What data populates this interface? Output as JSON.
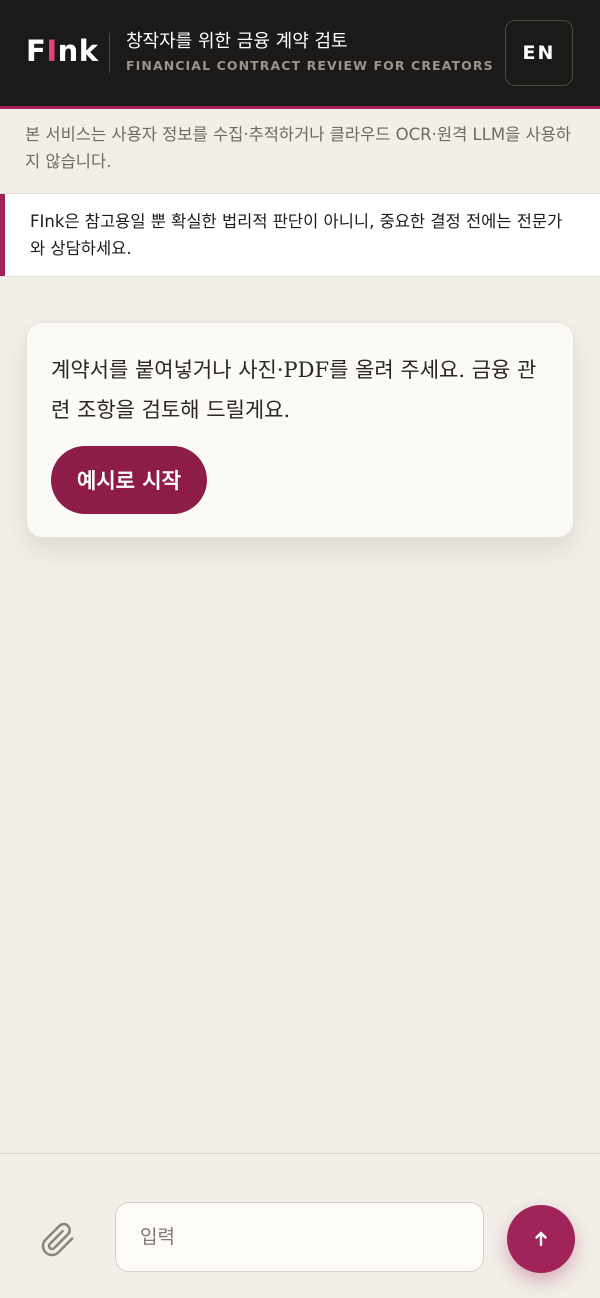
{
  "header": {
    "logo_prefix": "F",
    "logo_accent": "I",
    "logo_suffix": "nk",
    "title": "창작자를 위한 금융 계약 검토",
    "subtitle": "FINANCIAL CONTRACT REVIEW FOR CREATORS",
    "lang_button": "EN"
  },
  "privacy_note": "본 서비스는 사용자 정보를 수집·추적하거나 클라우드 OCR·원격 LLM을 사용하지 않습니다.",
  "notice": "FInk은 참고용일 뿐 확실한 법리적 판단이 아니니, 중요한 결정 전에는 전문가와 상담하세요.",
  "intro_card": {
    "message": "계약서를 붙여넣거나 사진·PDF를 올려 주세요. 금융 관련 조항을 검토해 드릴게요.",
    "example_button": "예시로 시작"
  },
  "composer": {
    "placeholder": "입력",
    "value": "",
    "attach_icon": "paperclip-icon",
    "send_icon": "arrow-up-icon"
  },
  "colors": {
    "accent": "#a0235a",
    "header_bg": "#1c1a18",
    "page_bg": "#f2efe8",
    "button_bg": "#8d1c48"
  }
}
